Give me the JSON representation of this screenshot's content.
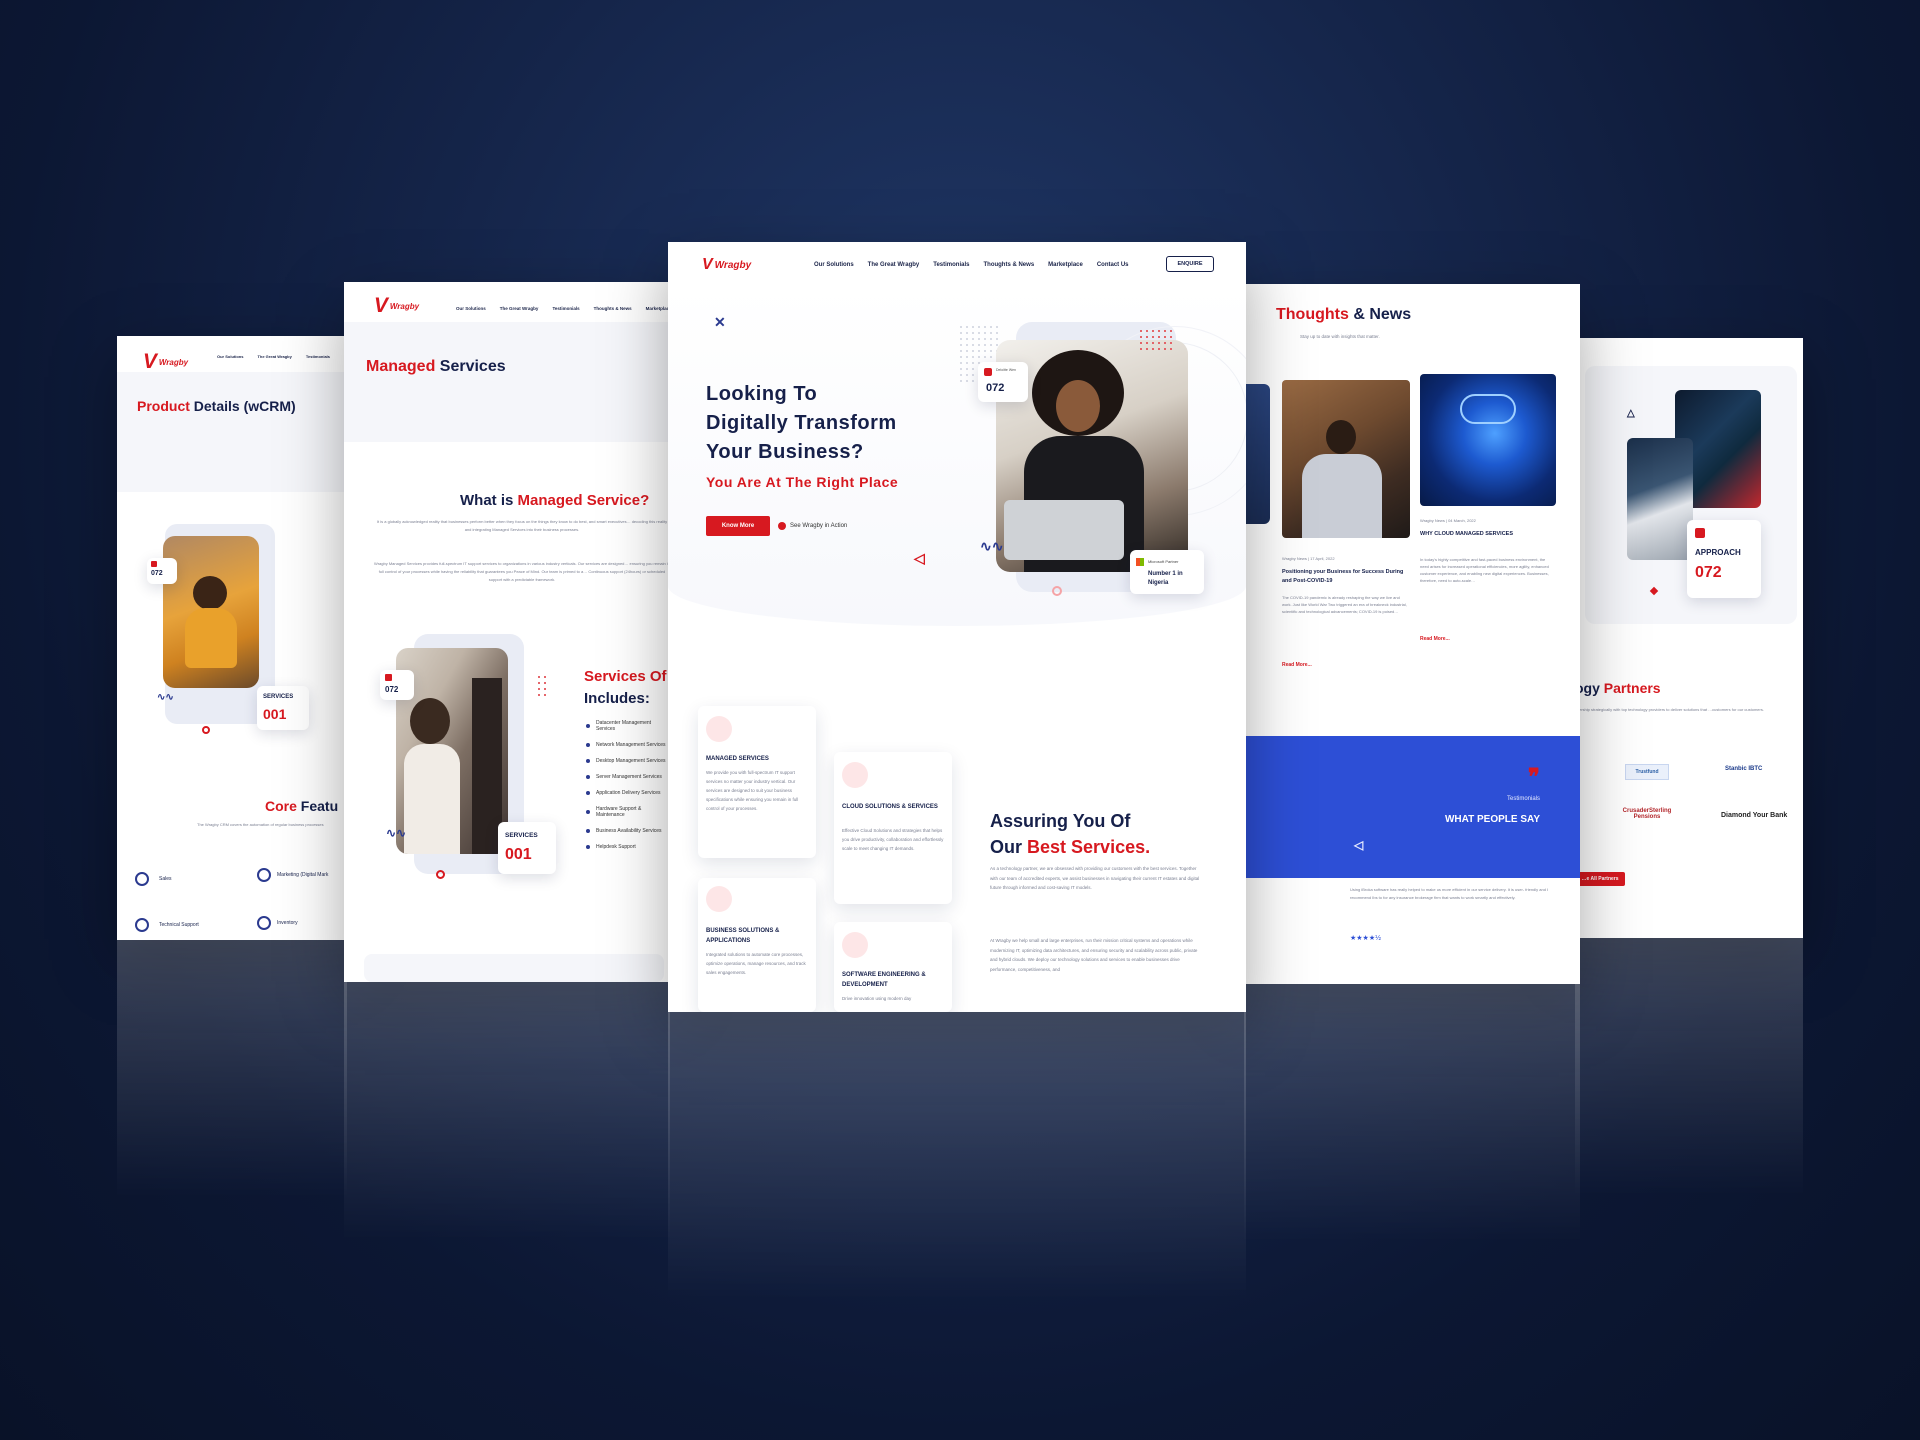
{
  "brand": {
    "logo": "Wragby"
  },
  "nav": {
    "solutions": "Our Solutions",
    "great": "The Great Wragby",
    "testimonials": "Testimonials",
    "thoughts": "Thoughts & News",
    "marketplace": "Marketplace",
    "contact": "Contact Us",
    "enquire": "ENQUIRE"
  },
  "page1": {
    "title_red": "Product",
    "title_rest": " Details (wCRM)",
    "award_num": "072",
    "services_label": "SERVICES",
    "services_num": "001",
    "core_red": "Core",
    "core_rest": " Featu",
    "core_text": "The Wragby CRM covers the automation of regular business processes",
    "features": [
      "Sales",
      "Marketing (Digital Mark",
      "Technical Support",
      "Inventory"
    ]
  },
  "page2": {
    "title_red": "Managed",
    "title_rest": " Services",
    "what_is": "What is ",
    "what_red": "Managed Service?",
    "para1": "It is a globally acknowledged reality that businesses perform better when they focus on the things they know to do best, and smart executives… decoding this reality and integrating Managed Services into their business processes.",
    "para2": "Wragby Managed Services provides full-spectrum IT support services to organizations in various industry verticals. Our services are designed… ensuring you remain in full control of your processes while having the reliability that guarantees you Peace of Mind. Our team is primed to a… Continuous support (24hours) or scheduled support with a predictable framework.",
    "award_num": "072",
    "services_label": "SERVICES",
    "services_num": "001",
    "offer_red": "Services Of",
    "offer_rest": "Includes:",
    "list": [
      "Datacenter Management Services",
      "Network Management Services",
      "Desktop Management Services",
      "Server Management Services",
      "Application Delivery Services",
      "Hardware Support & Maintenance",
      "Business Availability Services",
      "Helpdesk Support"
    ]
  },
  "hero": {
    "line1": "Looking To",
    "line2": "Digitally Transform",
    "line3": "Your Business?",
    "sub": "You Are At The Right Place",
    "cta": "Know More",
    "video": "See Wragby in Action",
    "award_small": "Deloitte Wen",
    "award_num": "072",
    "ms_label": "Microsoft Partner",
    "ms_text": "Number 1 in Nigeria"
  },
  "services": {
    "cards": [
      {
        "title": "MANAGED SERVICES",
        "text": "We provide you with full-spectrum IT support services no matter your industry vertical. Our services are designed to suit your business specifications while ensuring you remain in full control of your processes."
      },
      {
        "title": "CLOUD SOLUTIONS & SERVICES",
        "text": "Effective Cloud Solutions and strategies that helps you drive productivity, collaboration and effortlessly scale to meet changing IT demands."
      },
      {
        "title": "BUSINESS SOLUTIONS & APPLICATIONS",
        "text": "Integrated solutions to automate core processes, optimize operations, manage resources, and track sales engagements."
      },
      {
        "title": "SOFTWARE ENGINEERING & DEVELOPMENT",
        "text": "Drive innovation using modern day"
      }
    ],
    "assure_line1": "Assuring You Of",
    "assure_our": "Our ",
    "assure_red": "Best Services.",
    "para1": "As a technology partner, we are obsessed with providing our customers with the best services. Together with our team of accredited experts, we assist businesses in navigating their current IT estates and digital future through informed and cost-saving IT models.",
    "para2": "At Wragby we help small and large enterprises, run their mission critical systems and operations while modernizing IT, optimizing data architectures, and ensuring security and scalability across public, private and hybrid clouds. We deploy our technology solutions and services to enable businesses drive performance, competitiveness, and"
  },
  "news": {
    "title_red": "Thoughts",
    "title_rest": " & News",
    "sub": "Stay up to date with insights that matter.",
    "items": [
      {
        "meta": "Wragby News  |  17 April, 2022",
        "title": "Positioning your Business for Success During and Post-COVID-19",
        "text": "The COVID-19 pandemic is already reshaping the way we live and work. Just like World War Two triggered an era of breakneck industrial, scientific and technological advancements; COVID-19 is poised…",
        "more": "Read More..."
      },
      {
        "meta": "Wragby News  |  04 March, 2022",
        "title": "WHY CLOUD MANAGED SERVICES",
        "text": "In today's highly competitive and fast-paced business environment, the need arises for increased operational efficiencies, more agility, enhanced customer experience, and enabling new digital experiences. Businesses, therefore, need to auto-scale…",
        "more": "Read More..."
      }
    ],
    "testimonials": "Testimonials",
    "what_people": "WHAT PEOPLE SAY",
    "quote": "Using iBroka software has really helped to make us more efficient in our service delivery. It is user- friendly and I recommend Ibs to for any insurance brokerage firm that wants to work smartly and effectively.",
    "stars": "★★★★½"
  },
  "partners": {
    "approach": "APPROACH",
    "approach_num": "072",
    "tech_red": "Partners",
    "tech_rest": "ogy ",
    "text": "…ership strategically with top technology providers to deliver solutions that …customers for our customers.",
    "logos": [
      "Trustfund",
      "Stanbic IBTC",
      "CrusaderSterling Pensions",
      "Diamond Your Bank"
    ],
    "all_btn": "…e All Partners"
  },
  "colors": {
    "red": "#d71920",
    "navy": "#16204a",
    "blue": "#2d4fd6"
  }
}
